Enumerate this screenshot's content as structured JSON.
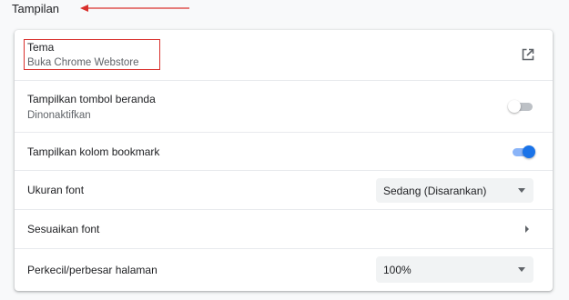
{
  "section": {
    "title": "Tampilan"
  },
  "rows": [
    {
      "label": "Tema",
      "sublabel": "Buka Chrome Webstore",
      "control": "external-link-icon"
    },
    {
      "label": "Tampilkan tombol beranda",
      "sublabel": "Dinonaktifkan",
      "control": "toggle",
      "on": false
    },
    {
      "label": "Tampilkan kolom bookmark",
      "control": "toggle",
      "on": true
    },
    {
      "label": "Ukuran font",
      "control": "select",
      "value": "Sedang (Disarankan)"
    },
    {
      "label": "Sesuaikan font",
      "control": "chevron-right-icon"
    },
    {
      "label": "Perkecil/perbesar halaman",
      "control": "select",
      "value": "100%"
    }
  ],
  "colors": {
    "accent": "#1a73e8",
    "annotation": "#d9302c",
    "toggle_off_track": "#bdc1c6",
    "toggle_on_track": "#8ab4f8"
  }
}
